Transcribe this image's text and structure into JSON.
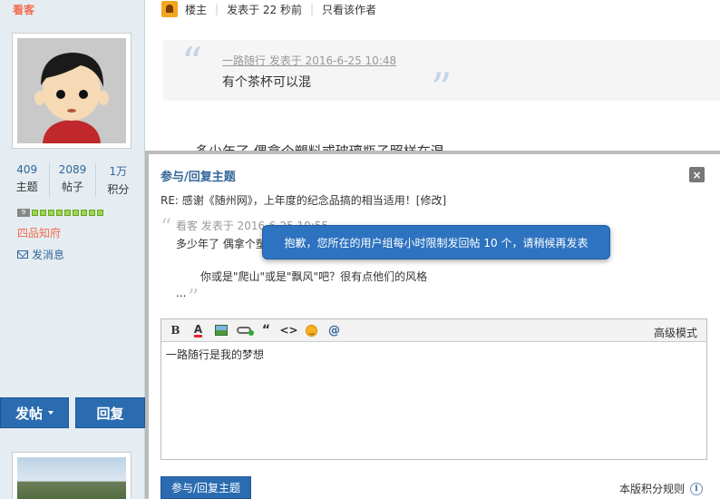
{
  "user": {
    "name": "看客",
    "stats": [
      {
        "value": "409",
        "label": "主题"
      },
      {
        "value": "2089",
        "label": "帖子"
      },
      {
        "value": "1万",
        "label": "积分"
      }
    ],
    "level": "9",
    "rank": "四品知府",
    "send_message": "发消息"
  },
  "buttons": {
    "post": "发帖",
    "reply": "回复"
  },
  "post": {
    "owner_label": "楼主",
    "posted_time": "发表于 22 秒前",
    "author_only": "只看该作者",
    "quote_meta": "一路随行 发表于 2016-6-25 10:48",
    "quote_text": "有个茶杯可以混",
    "body": "多少年了 偶拿个塑料或玻璃瓶子照样在混"
  },
  "dialog": {
    "title": "参与/回复主题",
    "close": "×",
    "subject": "RE: 感谢《随州网》，上年度的纪念品搞的相当适用！[修改]",
    "quote_meta": "看客 发表于 2016-6-25 10:55",
    "quote_line1": "多少年了 偶拿个塑料或玻璃瓶子照样在混",
    "quote_line2": "你或是\"爬山\"或是\"飘风\"吧？很有点他们的风格",
    "quote_line3": "...",
    "tooltip": "抱歉，您所在的用户组每小时限制发回帖 10 个，请稍候再发表",
    "advanced_mode": "高级模式",
    "editor_text": "一路随行是我的梦想",
    "submit": "参与/回复主题",
    "rules": "本版积分规则",
    "toolbar": {
      "bold": "B",
      "color": "A",
      "quote": "“",
      "code": "<>",
      "at": "@"
    }
  },
  "colors": {
    "accent": "#2b6cb1",
    "link": "#336699",
    "username": "#f26c4f",
    "sidebar_bg": "#e5edf2"
  }
}
